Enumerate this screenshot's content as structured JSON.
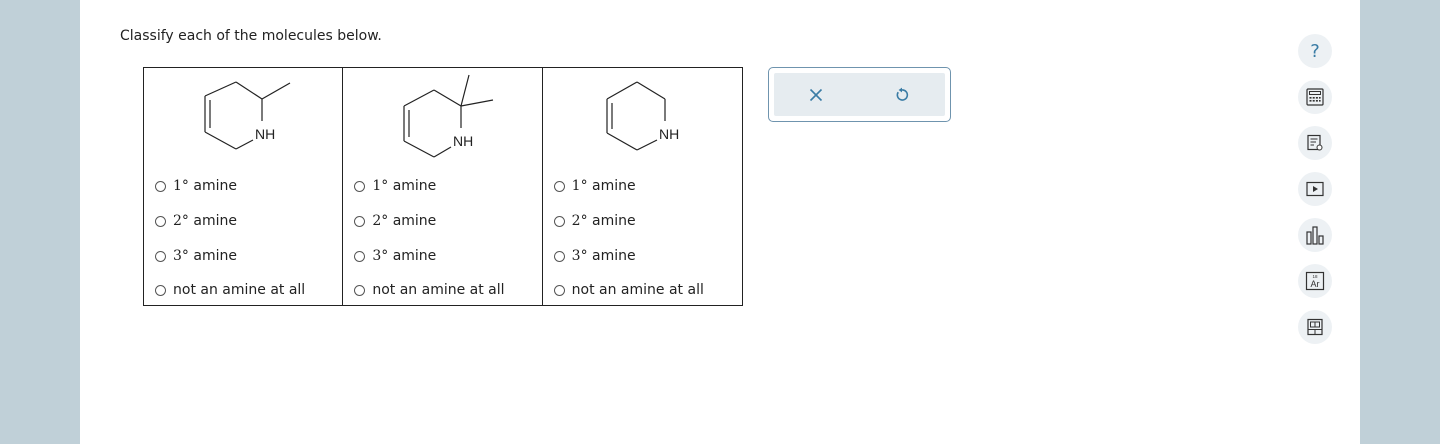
{
  "prompt": "Classify each of the molecules below.",
  "molecules": [
    {
      "nh_label": "NH",
      "options": [
        {
          "number": "1",
          "degree": "°",
          "text": " amine",
          "selected": false
        },
        {
          "number": "2",
          "degree": "°",
          "text": " amine",
          "selected": false
        },
        {
          "number": "3",
          "degree": "°",
          "text": " amine",
          "selected": false
        },
        {
          "number": "",
          "degree": "",
          "text": "not an amine at all",
          "selected": false
        }
      ]
    },
    {
      "nh_label": "NH",
      "options": [
        {
          "number": "1",
          "degree": "°",
          "text": " amine",
          "selected": false
        },
        {
          "number": "2",
          "degree": "°",
          "text": " amine",
          "selected": false
        },
        {
          "number": "3",
          "degree": "°",
          "text": " amine",
          "selected": false
        },
        {
          "number": "",
          "degree": "",
          "text": "not an amine at all",
          "selected": false
        }
      ]
    },
    {
      "nh_label": "NH",
      "options": [
        {
          "number": "1",
          "degree": "°",
          "text": " amine",
          "selected": false
        },
        {
          "number": "2",
          "degree": "°",
          "text": " amine",
          "selected": false
        },
        {
          "number": "3",
          "degree": "°",
          "text": " amine",
          "selected": false
        },
        {
          "number": "",
          "degree": "",
          "text": "not an amine at all",
          "selected": false
        }
      ]
    }
  ],
  "actions": {
    "clear_icon": "close-icon",
    "undo_icon": "undo-icon"
  },
  "tools": {
    "help_label": "?",
    "icons": [
      "help-icon",
      "calculator-icon",
      "reference-icon",
      "video-icon",
      "chart-icon",
      "periodic-table-icon",
      "device-icon"
    ],
    "periodic_number": "18",
    "periodic_symbol": "Ar"
  },
  "colors": {
    "accent": "#3a7ca5",
    "background": "#c0d0d8",
    "action_box_border": "#6f94ae"
  }
}
